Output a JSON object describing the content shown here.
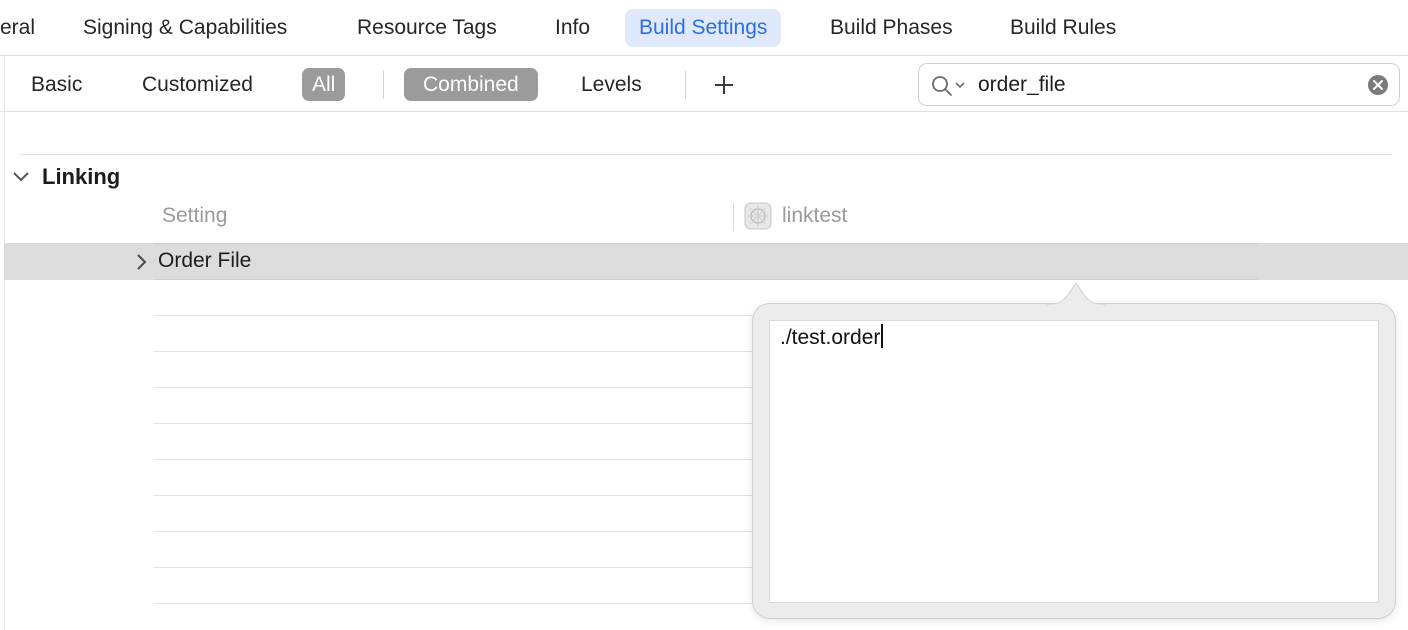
{
  "tabs": [
    {
      "label": "eral",
      "active": false
    },
    {
      "label": "Signing & Capabilities",
      "active": false
    },
    {
      "label": "Resource Tags",
      "active": false
    },
    {
      "label": "Info",
      "active": false
    },
    {
      "label": "Build Settings",
      "active": true
    },
    {
      "label": "Build Phases",
      "active": false
    },
    {
      "label": "Build Rules",
      "active": false
    }
  ],
  "filter": {
    "basic": "Basic",
    "customized": "Customized",
    "all": "All",
    "combined": "Combined",
    "levels": "Levels",
    "selected_scope": "All",
    "selected_view": "Combined"
  },
  "search": {
    "value": "order_file"
  },
  "section": {
    "title": "Linking",
    "expanded": true
  },
  "columns": {
    "setting": "Setting",
    "target": "linktest"
  },
  "row": {
    "label": "Order File",
    "selected": true
  },
  "popover": {
    "value": "./test.order"
  },
  "colors": {
    "accent": "#2c6fe0",
    "active_tab_bg": "#dfe9fb",
    "selected_segment_bg": "#9b9b9b",
    "selected_row_bg": "#dcdcdc"
  }
}
